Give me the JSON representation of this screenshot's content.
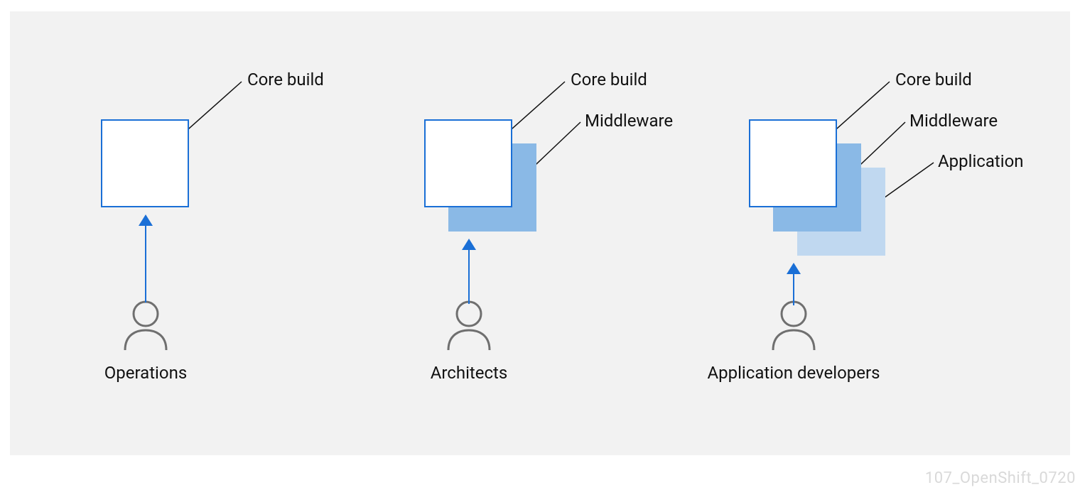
{
  "columns": [
    {
      "role": "Operations",
      "layers": [
        {
          "id": "core",
          "label": "Core build"
        }
      ]
    },
    {
      "role": "Architects",
      "layers": [
        {
          "id": "core",
          "label": "Core build"
        },
        {
          "id": "middleware",
          "label": "Middleware"
        }
      ]
    },
    {
      "role": "Application developers",
      "layers": [
        {
          "id": "core",
          "label": "Core build"
        },
        {
          "id": "middleware",
          "label": "Middleware"
        },
        {
          "id": "application",
          "label": "Application"
        }
      ]
    }
  ],
  "watermark": "107_OpenShift_0720",
  "palette": {
    "canvas_bg": "#f2f2f2",
    "core_border": "#1a6fd6",
    "core_fill": "#ffffff",
    "middleware_fill": "#8ab9e6",
    "application_fill": "#c0d8f0",
    "arrow": "#1a6fd6",
    "person_stroke": "#6f6f6f",
    "text": "#111111",
    "watermark": "#d9d9d9"
  }
}
